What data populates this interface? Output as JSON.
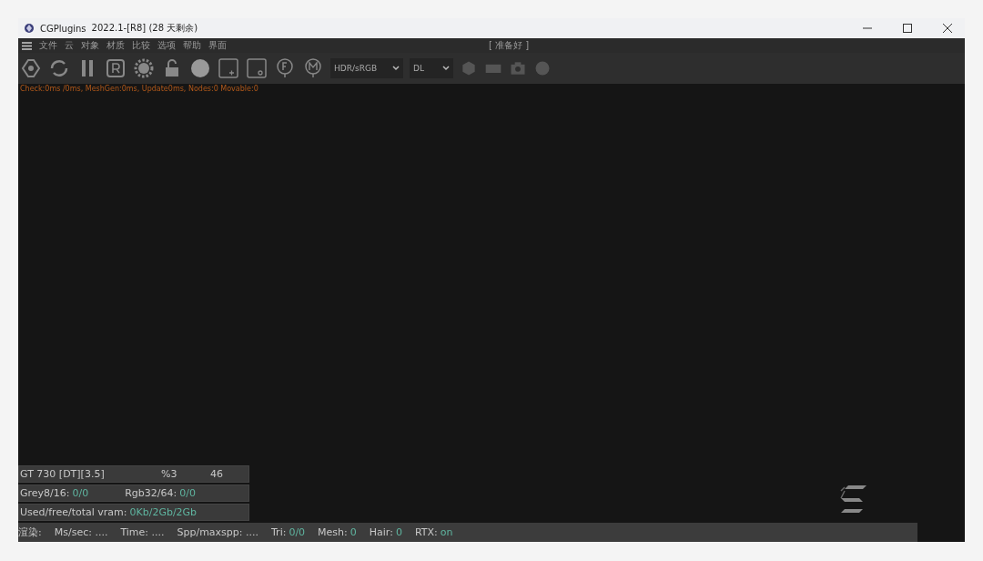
{
  "window": {
    "title": "CGPlugins",
    "version": "2022.1-[R8] (28 天剩余)"
  },
  "menu": {
    "items": [
      "文件",
      "云",
      "对象",
      "材质",
      "比较",
      "选项",
      "帮助",
      "界面"
    ],
    "status": "[ 准备好 ]"
  },
  "toolbar": {
    "dropdowns": [
      {
        "value": "HDR/sRGB"
      },
      {
        "value": "DL"
      }
    ]
  },
  "stats_line": "Check:0ms /0ms, MeshGen:0ms, Update0ms, Nodes:0 Movable:0",
  "info_panel": {
    "device": [
      "GT 730 [DT][3.5]",
      "%3",
      "46"
    ],
    "rows": [
      [
        {
          "label": "Grey8/16:",
          "value": "0/0"
        },
        {
          "label": "Rgb32/64:",
          "value": "0/0"
        }
      ],
      [
        {
          "label": "Used/free/total vram:",
          "value": "0Kb/2Gb/2Gb"
        }
      ]
    ]
  },
  "status_bar": [
    {
      "label": "渲染:"
    },
    {
      "label": "Ms/sec: ...."
    },
    {
      "label": "Time: ...."
    },
    {
      "label": "Spp/maxspp: ...."
    },
    {
      "label": "Tri:",
      "value": "0/0"
    },
    {
      "label": "Mesh:",
      "value": "0"
    },
    {
      "label": "Hair:",
      "value": "0"
    },
    {
      "label": "RTX:",
      "value": "on"
    }
  ]
}
